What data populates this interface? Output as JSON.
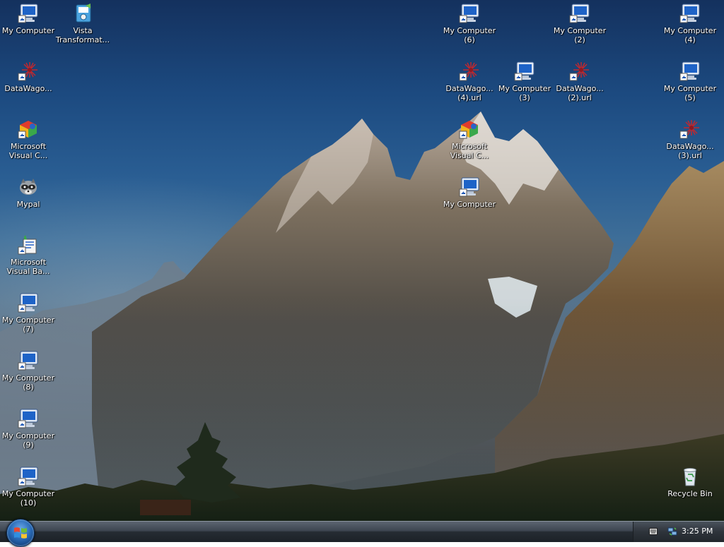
{
  "desktop": {
    "icons": [
      {
        "label": "My Computer",
        "icon": "computer-shortcut-icon"
      },
      {
        "label": "Vista\nTransformat...",
        "icon": "installer-icon"
      },
      {
        "label": "DataWago...",
        "icon": "url-shortcut-icon"
      },
      {
        "label": "Microsoft\nVisual C...",
        "icon": "visual-cpp-icon"
      },
      {
        "label": "Mypal",
        "icon": "mypal-raccoon-icon"
      },
      {
        "label": "Microsoft\nVisual Ba...",
        "icon": "visual-basic-icon"
      },
      {
        "label": "My Computer\n(7)",
        "icon": "computer-shortcut-icon"
      },
      {
        "label": "My Computer\n(8)",
        "icon": "computer-shortcut-icon"
      },
      {
        "label": "My Computer\n(9)",
        "icon": "computer-shortcut-icon"
      },
      {
        "label": "My Computer\n(10)",
        "icon": "computer-shortcut-icon"
      },
      {
        "label": "My Computer\n(6)",
        "icon": "computer-shortcut-icon"
      },
      {
        "label": "DataWago...\n(4).url",
        "icon": "url-shortcut-icon"
      },
      {
        "label": "Microsoft\nVisual C...",
        "icon": "visual-cpp-icon"
      },
      {
        "label": "My Computer",
        "icon": "computer-shortcut-icon"
      },
      {
        "label": "My Computer\n(3)",
        "icon": "computer-shortcut-icon"
      },
      {
        "label": "My Computer\n(2)",
        "icon": "computer-shortcut-icon"
      },
      {
        "label": "DataWago...\n(2).url",
        "icon": "url-shortcut-icon"
      },
      {
        "label": "My Computer\n(4)",
        "icon": "computer-shortcut-icon"
      },
      {
        "label": "My Computer\n(5)",
        "icon": "computer-shortcut-icon"
      },
      {
        "label": "DataWago...\n(3).url",
        "icon": "url-shortcut-icon"
      },
      {
        "label": "Recycle Bin",
        "icon": "recycle-bin-icon"
      }
    ]
  },
  "taskbar": {
    "start_icon": "windows-start-orb-icon",
    "tray": {
      "keyboard_icon": "keyboard-icon",
      "network_icon": "network-icon",
      "clock": "3:25 PM"
    }
  }
}
